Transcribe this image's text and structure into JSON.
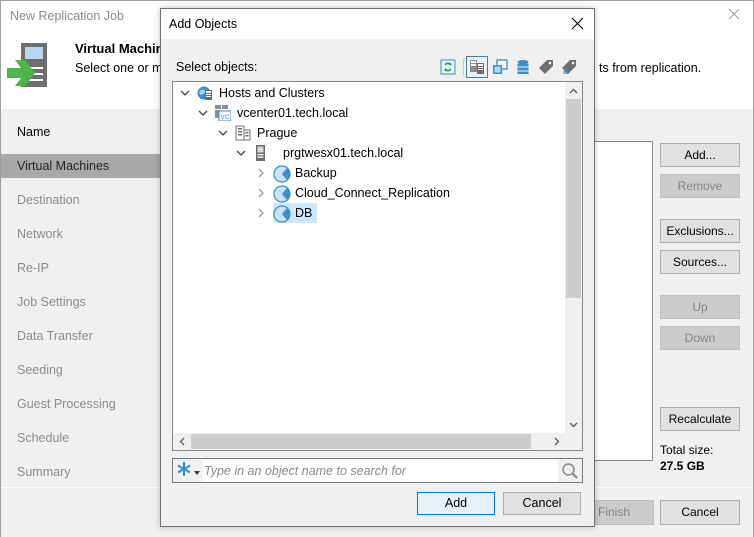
{
  "wizard": {
    "title": "New Replication Job",
    "header": {
      "title": "Virtual Machines",
      "description_start": "Select one or more VMs to process",
      "description_end": "ts from replication.",
      "icon": "vm-arrow-icon"
    },
    "nav": [
      {
        "label": "Name",
        "state": "done"
      },
      {
        "label": "Virtual Machines",
        "state": "active"
      },
      {
        "label": "Destination",
        "state": "pending"
      },
      {
        "label": "Network",
        "state": "pending"
      },
      {
        "label": "Re-IP",
        "state": "pending"
      },
      {
        "label": "Job Settings",
        "state": "pending"
      },
      {
        "label": "Data Transfer",
        "state": "pending"
      },
      {
        "label": "Seeding",
        "state": "pending"
      },
      {
        "label": "Guest Processing",
        "state": "pending"
      },
      {
        "label": "Schedule",
        "state": "pending"
      },
      {
        "label": "Summary",
        "state": "pending"
      }
    ],
    "side_buttons": {
      "add": "Add...",
      "remove": "Remove",
      "exclusions": "Exclusions...",
      "sources": "Sources...",
      "up": "Up",
      "down": "Down",
      "recalculate": "Recalculate"
    },
    "total_size_label": "Total size:",
    "total_size_value": "27.5 GB",
    "footer": {
      "finish": "Finish",
      "cancel": "Cancel"
    }
  },
  "dialog": {
    "title": "Add Objects",
    "select_label": "Select objects:",
    "toolbar": [
      {
        "name": "refresh-icon",
        "selected": false
      },
      {
        "name": "hosts-and-clusters-view-icon",
        "selected": true
      },
      {
        "name": "vms-and-templates-view-icon",
        "selected": false
      },
      {
        "name": "datastores-view-icon",
        "selected": false
      },
      {
        "name": "tags-view-icon",
        "selected": false
      },
      {
        "name": "tag-categories-view-icon",
        "selected": false
      }
    ],
    "tree": [
      {
        "label": "Hosts and Clusters",
        "level": 0,
        "expanded": true,
        "icon": "hosts-clusters-icon"
      },
      {
        "label": "vcenter01.tech.local",
        "level": 1,
        "expanded": true,
        "icon": "vcenter-icon"
      },
      {
        "label": "Prague",
        "level": 2,
        "expanded": true,
        "icon": "datacenter-icon"
      },
      {
        "label": "prgtwesx01.tech.local",
        "level": 3,
        "expanded": true,
        "icon": "esx-host-icon"
      },
      {
        "label": "Backup",
        "level": 4,
        "expanded": false,
        "icon": "resource-pool-icon"
      },
      {
        "label": "Cloud_Connect_Replication",
        "level": 4,
        "expanded": false,
        "icon": "resource-pool-icon"
      },
      {
        "label": "DB",
        "level": 4,
        "expanded": false,
        "icon": "resource-pool-icon",
        "selected": true
      }
    ],
    "search": {
      "placeholder": "Type in an object name to search for",
      "value": ""
    },
    "buttons": {
      "add": "Add",
      "cancel": "Cancel"
    }
  }
}
